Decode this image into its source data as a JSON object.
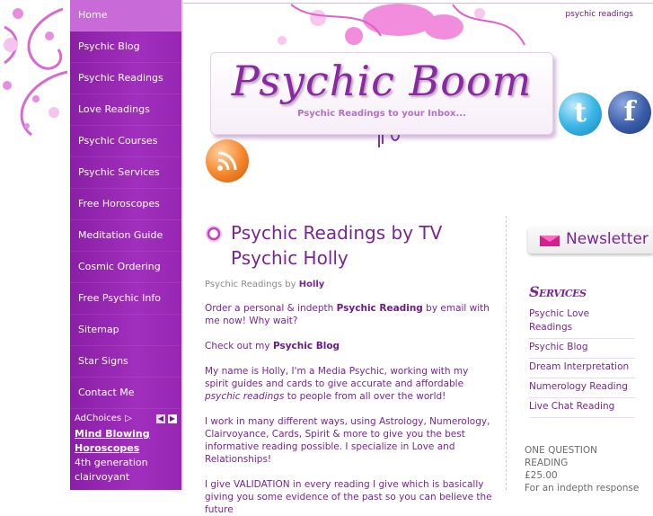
{
  "nav": {
    "items": [
      {
        "label": "Home",
        "active": true
      },
      {
        "label": "Psychic Blog"
      },
      {
        "label": "Psychic Readings"
      },
      {
        "label": "Love Readings"
      },
      {
        "label": "Psychic Courses"
      },
      {
        "label": "Psychic Services"
      },
      {
        "label": "Free Horoscopes"
      },
      {
        "label": "Meditation Guide"
      },
      {
        "label": "Cosmic Ordering"
      },
      {
        "label": "Free Psychic Info"
      },
      {
        "label": "Sitemap"
      },
      {
        "label": "Star Signs"
      },
      {
        "label": "Contact Me"
      }
    ]
  },
  "ad": {
    "choices_label": "AdChoices",
    "link_line1": "Mind Blowing",
    "link_line2": "Horoscopes",
    "text_line1": "4th generation",
    "text_line2": "clairvoyant"
  },
  "header": {
    "top_link": "psychic readings",
    "logo_title": "Psychic Boom",
    "logo_subtitle": "Psychic Readings to your Inbox..."
  },
  "article": {
    "title": "Psychic Readings by TV Psychic Holly",
    "byline_prefix": "Psychic Readings by ",
    "byline_author": "Holly",
    "p1_a": "Order a personal & indepth ",
    "p1_b": "Psychic Reading",
    "p1_c": " by email with me now! Why wait?",
    "p2_a": "Check out my ",
    "p2_b": "Psychic Blog",
    "p3_a": "My name is Holly, I'm a Media Psychic, working with my spirit guides and cards to give accurate and affordable ",
    "p3_b": "psychic readings",
    "p3_c": " to people from all over the world!",
    "p4": "I work in many different ways, using Astrology, Numerology, Clairvoyance, Cards, Spirit & more to give you the best informative reading possible. I specialize in Love and Relationships!",
    "p5": "I give VALIDATION in every reading I give which is basically giving you some evidence of the past so you can believe the future"
  },
  "sidebar": {
    "newsletter_label": "Newsletter",
    "services_heading": "Services",
    "services": [
      "Psychic Love Readings",
      "Psychic Blog",
      "Dream Interpretation",
      "Numerology Reading",
      "Live Chat Reading"
    ],
    "offer_title_1": "ONE QUESTION",
    "offer_title_2": "READING",
    "offer_price": "£25.00",
    "offer_text": "For an indepth response"
  },
  "colors": {
    "nav_bg": "#9726b3",
    "nav_active": "#c86ad8",
    "text_purple": "#7a2496",
    "accent_pink": "#d4208c"
  }
}
